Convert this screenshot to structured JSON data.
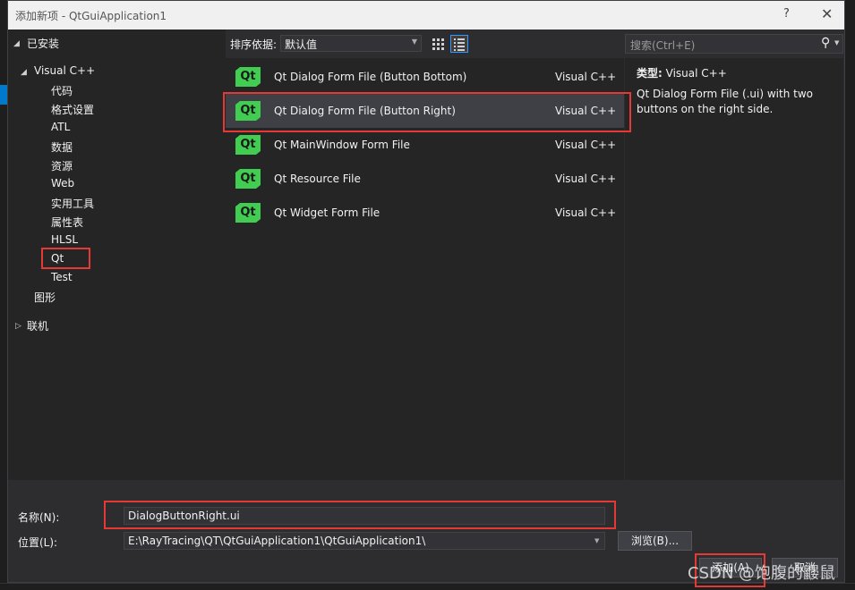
{
  "dialog": {
    "title": "添加新项 - QtGuiApplication1",
    "help_label": "?",
    "close_label": "✕"
  },
  "tree": {
    "installed": "已安装",
    "visual_cpp": "Visual C++",
    "children": [
      "代码",
      "格式设置",
      "ATL",
      "数据",
      "资源",
      "Web",
      "实用工具",
      "属性表",
      "HLSL",
      "Qt",
      "Test"
    ],
    "graphics": "图形",
    "online": "联机"
  },
  "toolbar": {
    "sort_label": "排序依据:",
    "sort_value": "默认值"
  },
  "templates": [
    {
      "name": "Qt Dialog Form File (Button Bottom)",
      "lang": "Visual C++"
    },
    {
      "name": "Qt Dialog Form File (Button Right)",
      "lang": "Visual C++"
    },
    {
      "name": "Qt MainWindow Form File",
      "lang": "Visual C++"
    },
    {
      "name": "Qt Resource File",
      "lang": "Visual C++"
    },
    {
      "name": "Qt Widget Form File",
      "lang": "Visual C++"
    }
  ],
  "logo_text": "Qt",
  "search": {
    "placeholder": "搜索(Ctrl+E)"
  },
  "details": {
    "type_label": "类型:",
    "type_value": "Visual C++",
    "description": "Qt Dialog Form File (.ui) with two buttons on the right side."
  },
  "form": {
    "name_label": "名称(N):",
    "name_value": "DialogButtonRight.ui",
    "location_label": "位置(L):",
    "location_value": "E:\\RayTracing\\QT\\QtGuiApplication1\\QtGuiApplication1\\",
    "browse_label": "浏览(B)...",
    "add_label": "添加(A)",
    "cancel_label": "取消"
  },
  "watermark": "CSDN @饱腹的鼹鼠",
  "colors": {
    "accent": "#007acc",
    "highlight": "#e53935",
    "qt_green": "#41cd52"
  }
}
